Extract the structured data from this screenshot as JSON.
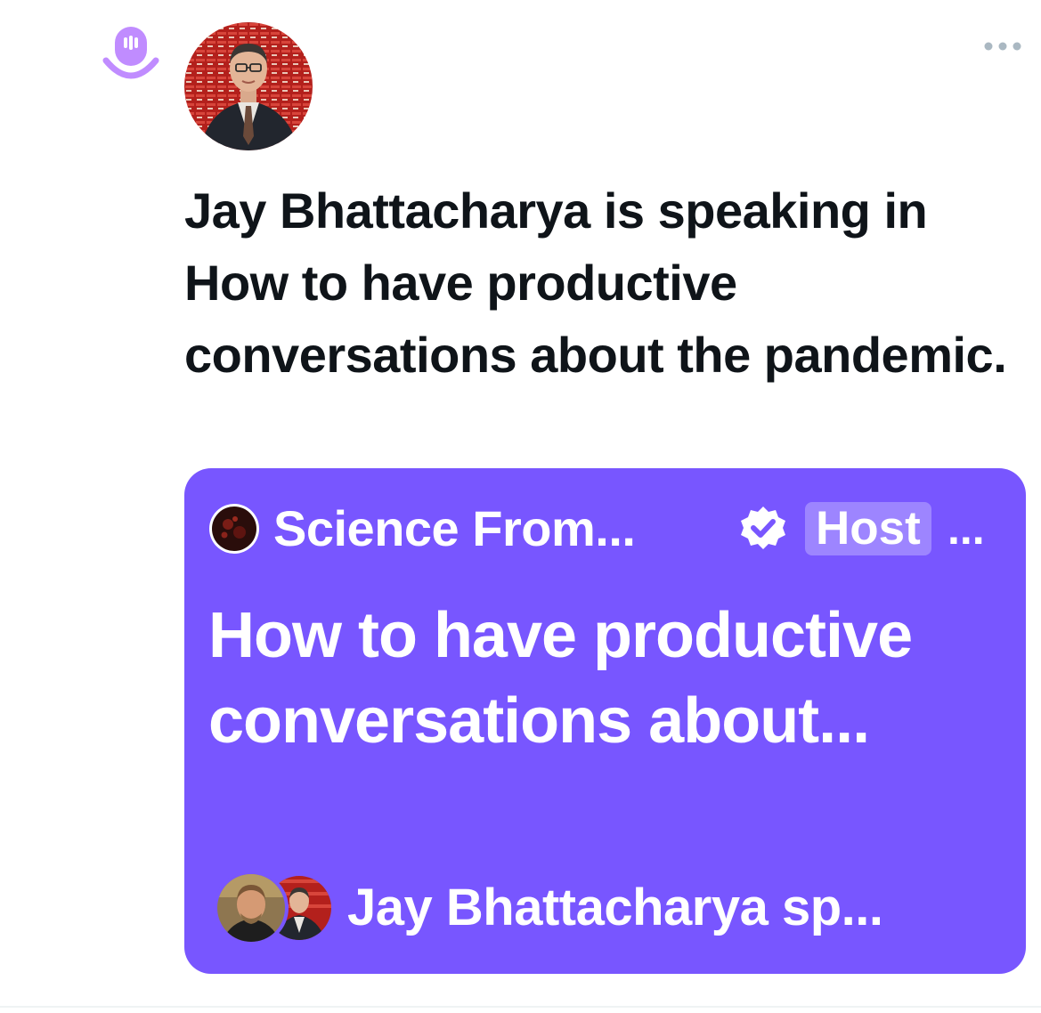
{
  "app": {
    "accent_color": "#7856ff",
    "spaces_icon": "spaces-microphone-icon",
    "more_icon": "more-horizontal-icon"
  },
  "post": {
    "headline": "Jay Bhattacharya is speaking in How to have productive conversations about the pandemic."
  },
  "space_card": {
    "host_name": "Science From...",
    "verified_icon": "verified-badge-icon",
    "host_label": "Host",
    "host_overflow": "...",
    "title": "How to have productive conversations about...",
    "speakers_text": "Jay Bhattacharya sp..."
  }
}
